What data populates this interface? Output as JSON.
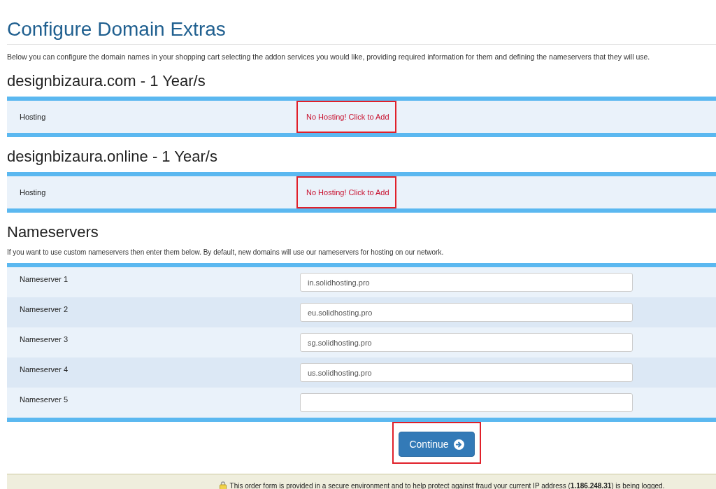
{
  "title": "Configure Domain Extras",
  "intro": "Below you can configure the domain names in your shopping cart selecting the addon services you would like, providing required information for them and defining the nameservers that they will use.",
  "domains": [
    {
      "heading": "designbizaura.com - 1 Year/s",
      "rows": [
        {
          "label": "Hosting",
          "action": "No Hosting! Click to Add",
          "highlighted": true
        }
      ]
    },
    {
      "heading": "designbizaura.online - 1 Year/s",
      "rows": [
        {
          "label": "Hosting",
          "action": "No Hosting! Click to Add",
          "highlighted": true
        }
      ]
    }
  ],
  "nameservers": {
    "heading": "Nameservers",
    "description": "If you want to use custom nameservers then enter them below. By default, new domains will use our nameservers for hosting on our network.",
    "rows": [
      {
        "label": "Nameserver 1",
        "value": "in.solidhosting.pro"
      },
      {
        "label": "Nameserver 2",
        "value": "eu.solidhosting.pro"
      },
      {
        "label": "Nameserver 3",
        "value": "sg.solidhosting.pro"
      },
      {
        "label": "Nameserver 4",
        "value": "us.solidhosting.pro"
      },
      {
        "label": "Nameserver 5",
        "value": ""
      }
    ]
  },
  "continue_button": {
    "label": "Continue",
    "highlighted": true
  },
  "security_notice": "This order form is provided in a secure environment and to help protect against fraud your current IP address (**1.186.248.31**) is being logged."
}
